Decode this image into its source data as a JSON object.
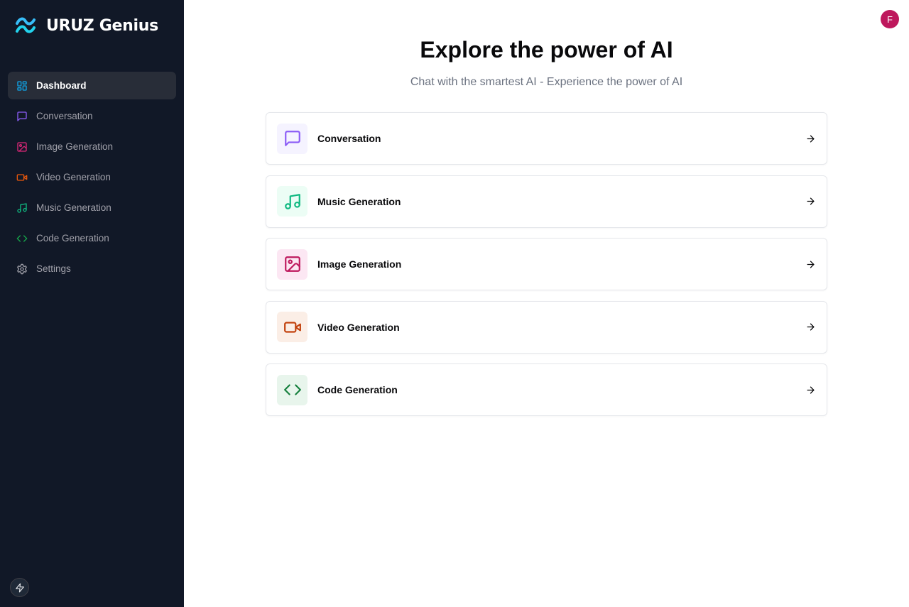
{
  "brand": {
    "name": "URUZ Genius",
    "logo_icon": "wave-logo-icon",
    "logo_color": "#38bdf8"
  },
  "sidebar": {
    "items": [
      {
        "label": "Dashboard",
        "icon": "layout-dashboard-icon",
        "color": "#0ea5e9",
        "active": true
      },
      {
        "label": "Conversation",
        "icon": "message-square-icon",
        "color": "#8b5cf6",
        "active": false
      },
      {
        "label": "Image Generation",
        "icon": "image-icon",
        "color": "#db2777",
        "active": false
      },
      {
        "label": "Video Generation",
        "icon": "video-icon",
        "color": "#ea580c",
        "active": false
      },
      {
        "label": "Music Generation",
        "icon": "music-icon",
        "color": "#10b981",
        "active": false
      },
      {
        "label": "Code Generation",
        "icon": "code-icon",
        "color": "#16a34a",
        "active": false
      },
      {
        "label": "Settings",
        "icon": "settings-icon",
        "color": "#a1a1aa",
        "active": false
      }
    ],
    "bottom_button_icon": "zap-icon"
  },
  "header": {
    "avatar_initial": "F",
    "avatar_color": "#be185d"
  },
  "main": {
    "title": "Explore the power of AI",
    "subtitle": "Chat with the smartest AI - Experience the power of AI",
    "cards": [
      {
        "label": "Conversation",
        "icon": "message-square-icon",
        "color": "#8b5cf6",
        "bg": "#f5f3ff"
      },
      {
        "label": "Music Generation",
        "icon": "music-icon",
        "color": "#10b981",
        "bg": "#ecfdf5"
      },
      {
        "label": "Image Generation",
        "icon": "image-icon",
        "color": "#be185d",
        "bg": "#fce7f3"
      },
      {
        "label": "Video Generation",
        "icon": "video-icon",
        "color": "#c2410c",
        "bg": "#fbeee6"
      },
      {
        "label": "Code Generation",
        "icon": "code-icon",
        "color": "#15803d",
        "bg": "#e8f5ec"
      }
    ],
    "arrow_icon": "arrow-right-icon"
  }
}
